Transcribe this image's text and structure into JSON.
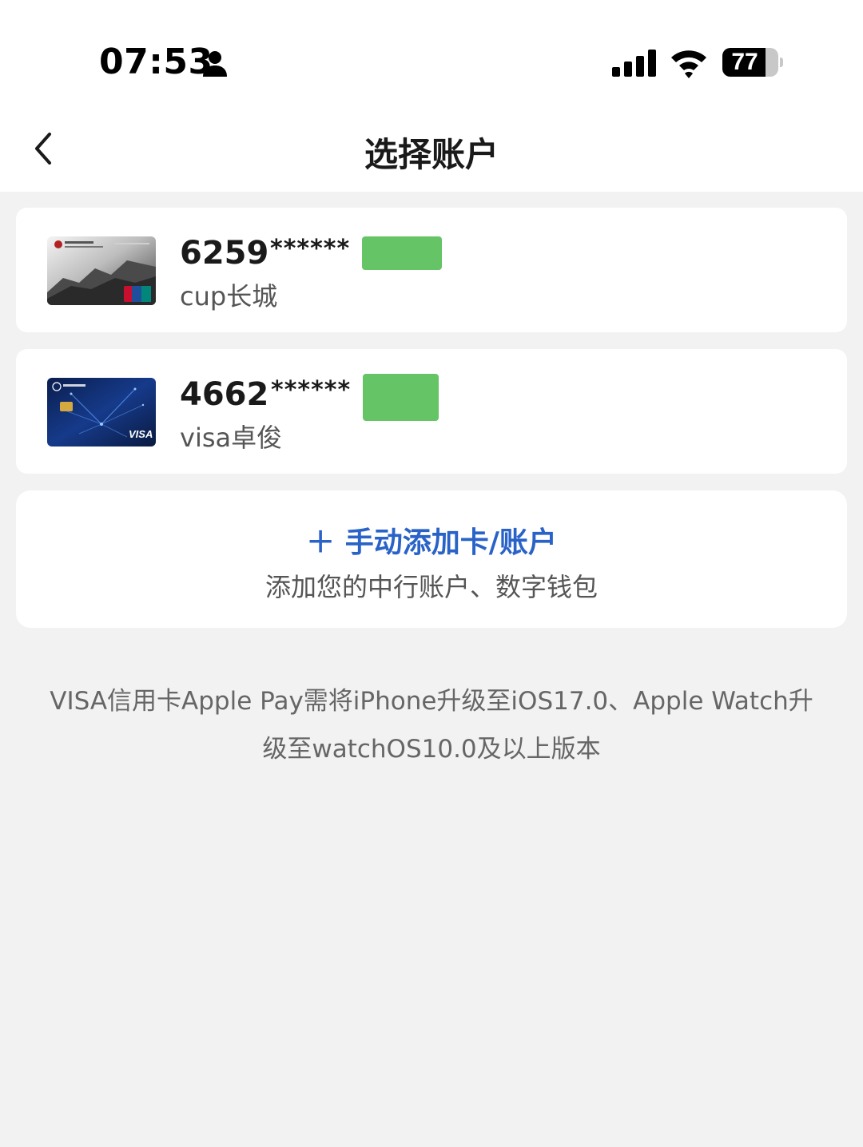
{
  "status": {
    "time": "07:53",
    "battery": "77",
    "battery_level": 0.77
  },
  "nav": {
    "title": "选择账户"
  },
  "accounts": [
    {
      "number": "6259",
      "mask": "******",
      "name": "cup长城",
      "card_art": "great-wall-platinum-card"
    },
    {
      "number": "4662",
      "mask": "******",
      "name": "visa卓俊",
      "card_art": "visa-platinum-card"
    }
  ],
  "add_account": {
    "title": "＋ 手动添加卡/账户",
    "subtitle": "添加您的中行账户、数字钱包"
  },
  "notice": {
    "line1": "VISA信用卡Apple Pay需将iPhone升级至iOS17.0、Apple Watch升",
    "line2": "级至watchOS10.0及以上版本"
  },
  "colors": {
    "accent": "#2a63c8",
    "redaction": "#65c466",
    "background": "#f2f2f2"
  }
}
